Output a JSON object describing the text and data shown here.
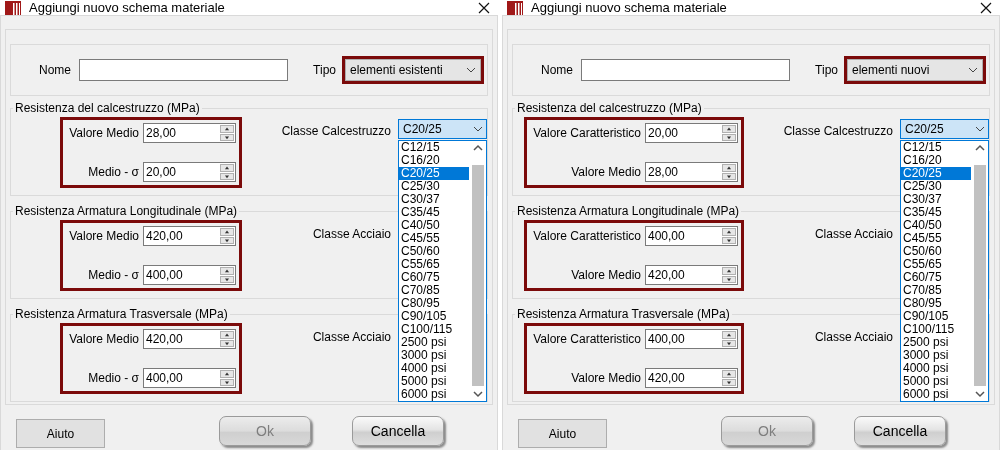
{
  "dialogs": [
    {
      "title": "Aggiungi nuovo schema materiale",
      "nome": {
        "label": "Nome"
      },
      "tipo": {
        "label": "Tipo",
        "value": "elementi esistenti"
      },
      "sections": [
        {
          "title": "Resistenza del calcestruzzo (MPa)",
          "fields": [
            {
              "label": "Valore Medio",
              "value": "28,00"
            },
            {
              "label": "Medio - σ",
              "value": "20,00"
            }
          ],
          "class_label": "Classe Calcestruzzo",
          "combo": {
            "value": "C20/25",
            "open": true
          }
        },
        {
          "title": "Resistenza Armatura Longitudinale (MPa)",
          "fields": [
            {
              "label": "Valore Medio",
              "value": "420,00"
            },
            {
              "label": "Medio - σ",
              "value": "400,00"
            }
          ],
          "class_label": "Classe Acciaio"
        },
        {
          "title": "Resistenza Armatura Trasversale (MPa)",
          "fields": [
            {
              "label": "Valore Medio",
              "value": "420,00"
            },
            {
              "label": "Medio - σ",
              "value": "400,00"
            }
          ],
          "class_label": "Classe Acciaio"
        }
      ],
      "dropdown": {
        "items": [
          {
            "label": "C12/15",
            "selected": false
          },
          {
            "label": "C16/20",
            "selected": false
          },
          {
            "label": "C20/25",
            "selected": true
          },
          {
            "label": "C25/30",
            "selected": false
          },
          {
            "label": "C30/37",
            "selected": false
          },
          {
            "label": "C35/45",
            "selected": false
          },
          {
            "label": "C40/50",
            "selected": false
          },
          {
            "label": "C45/55",
            "selected": false
          },
          {
            "label": "C50/60",
            "selected": false
          },
          {
            "label": "C55/65",
            "selected": false
          },
          {
            "label": "C60/75",
            "selected": false
          },
          {
            "label": "C70/85",
            "selected": false
          },
          {
            "label": "C80/95",
            "selected": false
          },
          {
            "label": "C90/105",
            "selected": false
          },
          {
            "label": "C100/115",
            "selected": false
          },
          {
            "label": "2500 psi",
            "selected": false
          },
          {
            "label": "3000 psi",
            "selected": false
          },
          {
            "label": "4000 psi",
            "selected": false
          },
          {
            "label": "5000 psi",
            "selected": false
          },
          {
            "label": "6000 psi",
            "selected": false
          }
        ]
      },
      "buttons": [
        {
          "label": "Aiuto",
          "kind": "flat",
          "disabled": false
        },
        {
          "label": "Ok",
          "kind": "glossy",
          "disabled": true
        },
        {
          "label": "Cancella",
          "kind": "glossy",
          "disabled": false
        }
      ]
    },
    {
      "title": "Aggiungi nuovo schema materiale",
      "nome": {
        "label": "Nome"
      },
      "tipo": {
        "label": "Tipo",
        "value": "elementi nuovi"
      },
      "sections": [
        {
          "title": "Resistenza del calcestruzzo (MPa)",
          "fields": [
            {
              "label": "Valore Caratteristico",
              "value": "20,00"
            },
            {
              "label": "Valore Medio",
              "value": "28,00"
            }
          ],
          "class_label": "Classe Calcestruzzo",
          "combo": {
            "value": "C20/25",
            "open": true
          }
        },
        {
          "title": "Resistenza Armatura Longitudinale (MPa)",
          "fields": [
            {
              "label": "Valore Caratteristico",
              "value": "400,00"
            },
            {
              "label": "Valore Medio",
              "value": "420,00"
            }
          ],
          "class_label": "Classe Acciaio"
        },
        {
          "title": "Resistenza Armatura Trasversale (MPa)",
          "fields": [
            {
              "label": "Valore Caratteristico",
              "value": "400,00"
            },
            {
              "label": "Valore Medio",
              "value": "420,00"
            }
          ],
          "class_label": "Classe Acciaio"
        }
      ],
      "dropdown": {
        "items": [
          {
            "label": "C12/15",
            "selected": false
          },
          {
            "label": "C16/20",
            "selected": false
          },
          {
            "label": "C20/25",
            "selected": true
          },
          {
            "label": "C25/30",
            "selected": false
          },
          {
            "label": "C30/37",
            "selected": false
          },
          {
            "label": "C35/45",
            "selected": false
          },
          {
            "label": "C40/50",
            "selected": false
          },
          {
            "label": "C45/55",
            "selected": false
          },
          {
            "label": "C50/60",
            "selected": false
          },
          {
            "label": "C55/65",
            "selected": false
          },
          {
            "label": "C60/75",
            "selected": false
          },
          {
            "label": "C70/85",
            "selected": false
          },
          {
            "label": "C80/95",
            "selected": false
          },
          {
            "label": "C90/105",
            "selected": false
          },
          {
            "label": "C100/115",
            "selected": false
          },
          {
            "label": "2500 psi",
            "selected": false
          },
          {
            "label": "3000 psi",
            "selected": false
          },
          {
            "label": "4000 psi",
            "selected": false
          },
          {
            "label": "5000 psi",
            "selected": false
          },
          {
            "label": "6000 psi",
            "selected": false
          }
        ]
      },
      "buttons": [
        {
          "label": "Aiuto",
          "kind": "flat",
          "disabled": false
        },
        {
          "label": "Ok",
          "kind": "glossy",
          "disabled": true
        },
        {
          "label": "Cancella",
          "kind": "glossy",
          "disabled": false
        }
      ]
    }
  ]
}
